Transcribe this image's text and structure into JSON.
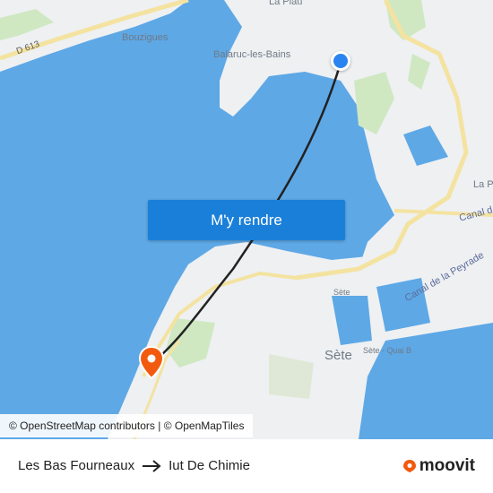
{
  "map": {
    "places": {
      "la_plagne_top": "La Plau",
      "bouzigues": "Bouzigues",
      "balaruc": "Balaruc-les-Bains",
      "road_d613": "D 613",
      "la_p": "La P",
      "canal_d": "Canal d",
      "canal_peyrade": "Canal de la Peyrade",
      "sete_small": "Sète",
      "sete_big": "Sète",
      "sete_quai": "Sète - Quai B"
    },
    "route_button_label": "M'y rendre",
    "attribution": "© OpenStreetMap contributors | © OpenMapTiles",
    "colors": {
      "water": "#5ea8e6",
      "land": "#eef0f2",
      "park": "#cfe8c2",
      "route": "#222222",
      "origin": "#2a84f0",
      "destination": "#f25a0f"
    },
    "icons": {
      "origin": "location-dot-icon",
      "destination": "map-pin-icon"
    }
  },
  "footer": {
    "origin": "Les Bas Fourneaux",
    "destination": "Iut De Chimie",
    "arrow": "arrow-right-icon",
    "brand": "moovit"
  }
}
